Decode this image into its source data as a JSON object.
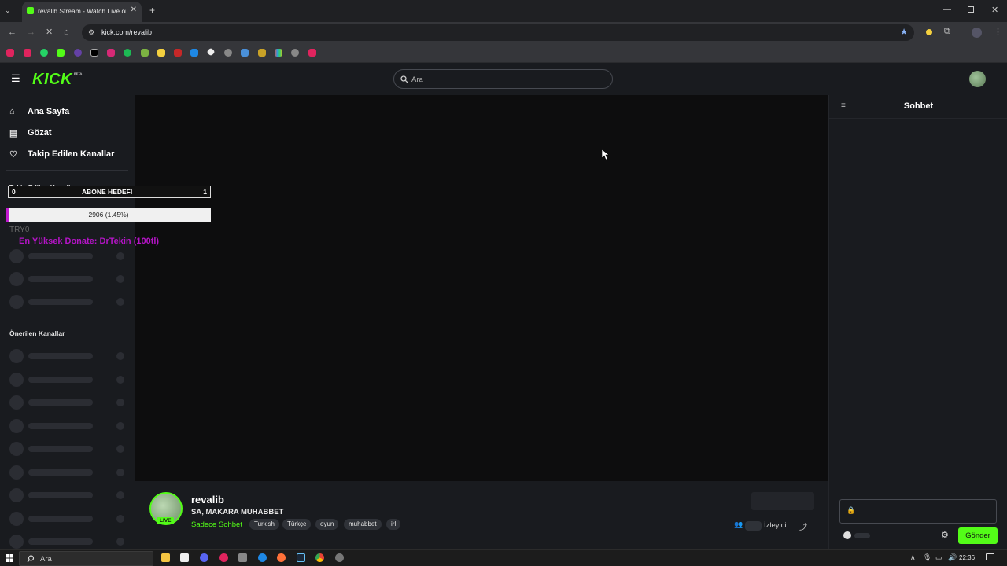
{
  "browser": {
    "tab_title": "revalib Stream - Watch Live on Kick",
    "url": "kick.com/revalib",
    "bookmark_icons": [
      "youtube-icon",
      "youtube-icon",
      "whatsapp-icon",
      "kick-icon",
      "twitch-icon",
      "x-icon",
      "instagram-icon",
      "app-icon",
      "spotify-icon",
      "app-icon",
      "app-icon",
      "app-icon",
      "app-icon",
      "app-icon",
      "app-icon",
      "app-icon",
      "app-icon",
      "app-icon",
      "youtube-icon"
    ]
  },
  "header": {
    "logo": "KICK",
    "logo_badge": "BETA",
    "search_placeholder": "Ara"
  },
  "sidebar": {
    "nav": [
      {
        "label": "Ana Sayfa",
        "icon": "home-icon"
      },
      {
        "label": "Gözat",
        "icon": "browse-icon"
      },
      {
        "label": "Takip Edilen Kanallar",
        "icon": "heart-icon"
      }
    ],
    "followed_title": "Takip Edilen Kanallar",
    "recommended_title": "Önerilen Kanallar"
  },
  "overlay": {
    "goal_left": "0",
    "goal_title": "ABONE HEDEFİ",
    "goal_right": "1",
    "progress_text": "2906 (1.45%)",
    "progress_fraction": 0.0145,
    "try_text": "TRY0",
    "donate_text": "En Yüksek Donate: DrTekin (100tl)"
  },
  "channel": {
    "name": "revalib",
    "live_badge": "LIVE",
    "title": "SA, MAKARA MUHABBET",
    "category": "Sadece Sohbet",
    "tags": [
      "Turkish",
      "Türkçe",
      "oyun",
      "muhabbet",
      "irl"
    ],
    "viewers_label": "İzleyici"
  },
  "chat": {
    "title": "Sohbet",
    "send_label": "Gönder"
  },
  "taskbar": {
    "search_placeholder": "Ara",
    "time": "22:36"
  },
  "colors": {
    "accent": "#53fc18",
    "overlay_purple": "#b514c7"
  }
}
